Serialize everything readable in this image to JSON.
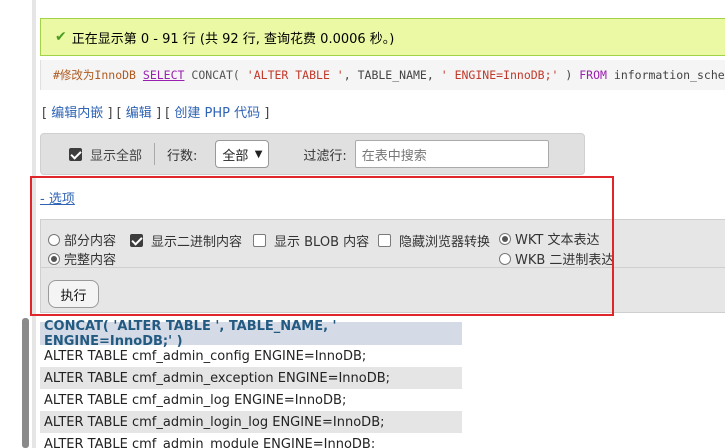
{
  "success_message": "正在显示第 0 - 91 行 (共 92 行, 查询花费 0.0006 秒。)",
  "sql": {
    "comment": "#修改为InnoDB",
    "select": "SELECT",
    "concat": "CONCAT(",
    "str1": "'ALTER TABLE '",
    "sep1": ",",
    "arg": "TABLE_NAME",
    "sep2": ",",
    "str2": "' ENGINE=InnoDB;'",
    "close": ")",
    "from": "FROM",
    "rest": "information_schema"
  },
  "links": {
    "open1": "[",
    "edit_inline": "编辑内嵌",
    "mid1": "] [",
    "edit": "编辑",
    "mid2": "] [",
    "create_php": "创建 PHP 代码",
    "close": "]"
  },
  "filter": {
    "show_all": "显示全部",
    "rows_label": "行数:",
    "rows_value": "全部",
    "filter_label": "过滤行:",
    "search_placeholder": "在表中搜索"
  },
  "options_link": "- 选项",
  "options": {
    "partial": "部分内容",
    "full": "完整内容",
    "show_binary": "显示二进制内容",
    "show_blob": "显示 BLOB 内容",
    "hide_transform": "隐藏浏览器转换",
    "wkt": "WKT 文本表达",
    "wkb": "WKB 二进制表达",
    "execute": "执行"
  },
  "results": {
    "header": "CONCAT( 'ALTER TABLE ', TABLE_NAME, ' ENGINE=InnoDB;' )",
    "rows": [
      "ALTER TABLE cmf_admin_config ENGINE=InnoDB;",
      "ALTER TABLE cmf_admin_exception ENGINE=InnoDB;",
      "ALTER TABLE cmf_admin_log ENGINE=InnoDB;",
      "ALTER TABLE cmf_admin_login_log ENGINE=InnoDB;",
      "ALTER TABLE cmf_admin_module ENGINE=InnoDB;"
    ]
  },
  "colors": {
    "accent_link": "#2f63b5",
    "success_bg": "#ebf8a4",
    "highlight_border": "#e0262b"
  }
}
